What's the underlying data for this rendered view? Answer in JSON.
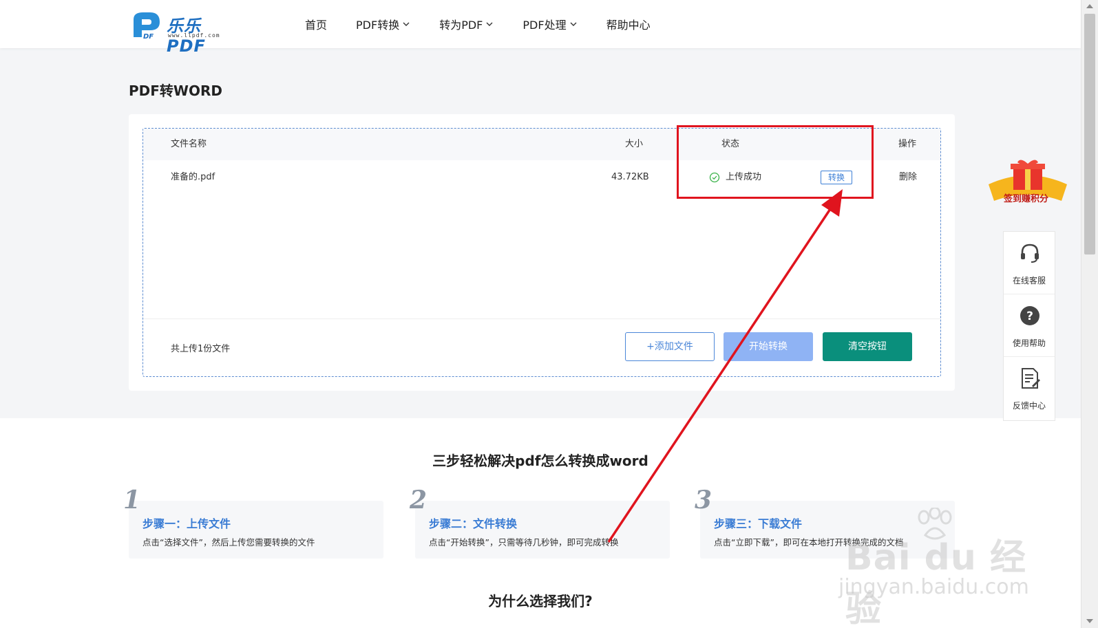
{
  "header": {
    "logo_brand": "乐乐PDF",
    "logo_url": "www.llpdf.com",
    "nav": [
      {
        "label": "首页",
        "has_dropdown": false
      },
      {
        "label": "PDF转换",
        "has_dropdown": true
      },
      {
        "label": "转为PDF",
        "has_dropdown": true
      },
      {
        "label": "PDF处理",
        "has_dropdown": true
      },
      {
        "label": "帮助中心",
        "has_dropdown": false
      }
    ]
  },
  "page_title": "PDF转WORD",
  "table": {
    "headers": {
      "name": "文件名称",
      "size": "大小",
      "status": "状态",
      "op": "操作"
    },
    "rows": [
      {
        "name": "准备的.pdf",
        "size": "43.72KB",
        "status": "上传成功",
        "convert": "转换",
        "delete": "删除"
      }
    ]
  },
  "footer": {
    "count_text": "共上传1份文件",
    "add_label": "+添加文件",
    "start_label": "开始转换",
    "clear_label": "清空按钮"
  },
  "lower": {
    "section_title": "三步轻松解决pdf怎么转换成word",
    "steps": [
      {
        "num": "1",
        "title": "步骤一：上传文件",
        "desc": "点击“选择文件”，然后上传您需要转换的文件"
      },
      {
        "num": "2",
        "title": "步骤二：文件转换",
        "desc": "点击“开始转换”，只需等待几秒钟，即可完成转换"
      },
      {
        "num": "3",
        "title": "步骤三：下载文件",
        "desc": "点击“立即下载”，即可在本地打开转换完成的文档"
      }
    ],
    "why_title": "为什么选择我们?"
  },
  "side": {
    "gift_label": "签到赚积分",
    "items": [
      {
        "label": "在线客服",
        "icon": "headset-icon"
      },
      {
        "label": "使用帮助",
        "icon": "help-icon"
      },
      {
        "label": "反馈中心",
        "icon": "feedback-icon"
      }
    ]
  },
  "watermark": {
    "brand": "Bai du 经验",
    "domain": "jingyan.baidu.com"
  },
  "colors": {
    "annotation": "#e0141e",
    "link_blue": "#3d7fd6",
    "start_btn": "#8fb3f4",
    "clear_btn": "#0a8f7c"
  }
}
